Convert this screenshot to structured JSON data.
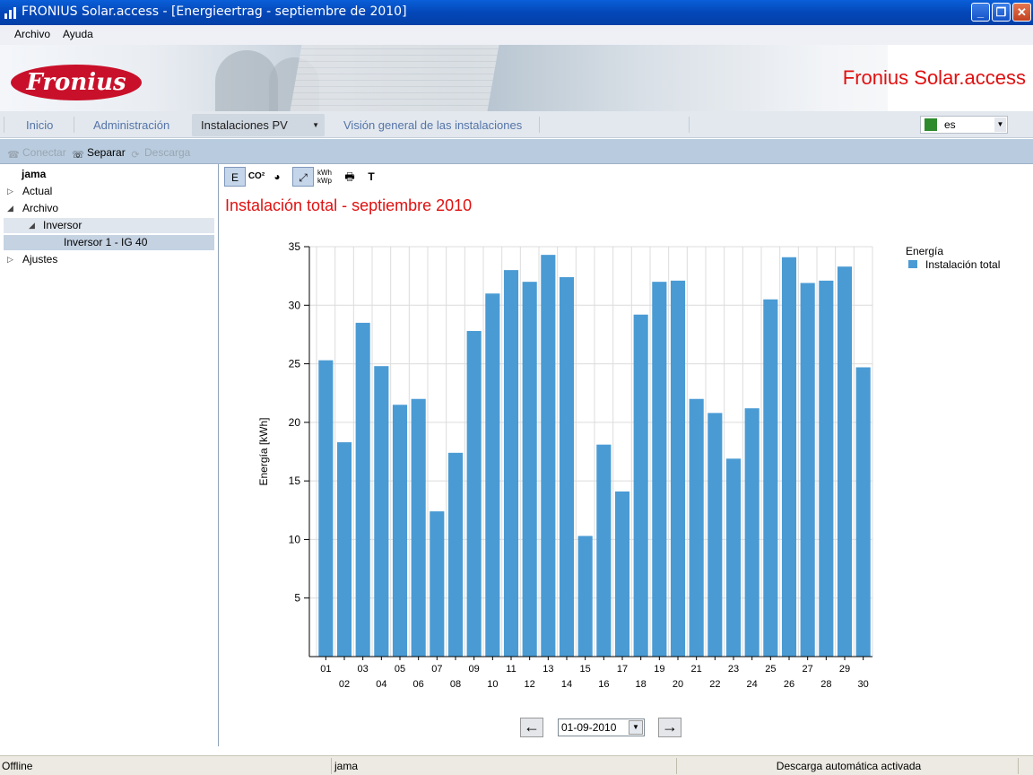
{
  "window": {
    "title": "FRONIUS Solar.access - [Energieertrag - septiembre de 2010]"
  },
  "menu": {
    "items": [
      "Archivo",
      "Ayuda"
    ]
  },
  "banner": {
    "logo_text": "Fronius",
    "brand_title": "Fronius Solar.access"
  },
  "nav": {
    "tabs": [
      "Inicio",
      "Administración",
      "Instalaciones PV",
      "Visión general de las instalaciones"
    ],
    "active_tab": "Instalaciones PV",
    "language": "es"
  },
  "toolbar": {
    "connect": "Conectar",
    "separate": "Separar",
    "download": "Descarga"
  },
  "tree": {
    "root": "jama",
    "items": [
      "Actual",
      "Archivo",
      "Inversor",
      "Inversor 1 - IG 40",
      "Ajustes"
    ]
  },
  "chart_toolbar": {
    "energy": "E",
    "co2": "CO²",
    "kwh_kwp_top": "kWh",
    "kwh_kwp_bottom": "kWp",
    "text": "T"
  },
  "content": {
    "heading": "Instalación total - septiembre 2010"
  },
  "chart_data": {
    "type": "bar",
    "categories": [
      "01",
      "02",
      "03",
      "04",
      "05",
      "06",
      "07",
      "08",
      "09",
      "10",
      "11",
      "12",
      "13",
      "14",
      "15",
      "16",
      "17",
      "18",
      "19",
      "20",
      "21",
      "22",
      "23",
      "24",
      "25",
      "26",
      "27",
      "28",
      "29",
      "30"
    ],
    "series": [
      {
        "name": "Instalación total",
        "values": [
          25.3,
          18.3,
          28.5,
          24.8,
          21.5,
          22.0,
          12.4,
          17.4,
          27.8,
          31.0,
          33.0,
          32.0,
          34.3,
          32.4,
          10.3,
          18.1,
          14.1,
          29.2,
          32.0,
          32.1,
          22.0,
          20.8,
          16.9,
          21.2,
          30.5,
          34.1,
          31.9,
          32.1,
          33.3,
          24.7
        ]
      }
    ],
    "ylabel": "Energía [kWh]",
    "ylim": [
      0,
      35
    ],
    "yticks": [
      5,
      10,
      15,
      20,
      25,
      30,
      35
    ],
    "legend": {
      "title": "Energía",
      "position": "top-right"
    },
    "grid": true,
    "bar_color": "#4a9bd4"
  },
  "date_nav": {
    "value": "01-09-2010"
  },
  "status": {
    "connection": "Offline",
    "system": "jama",
    "auto_download": "Descarga automática activada"
  }
}
